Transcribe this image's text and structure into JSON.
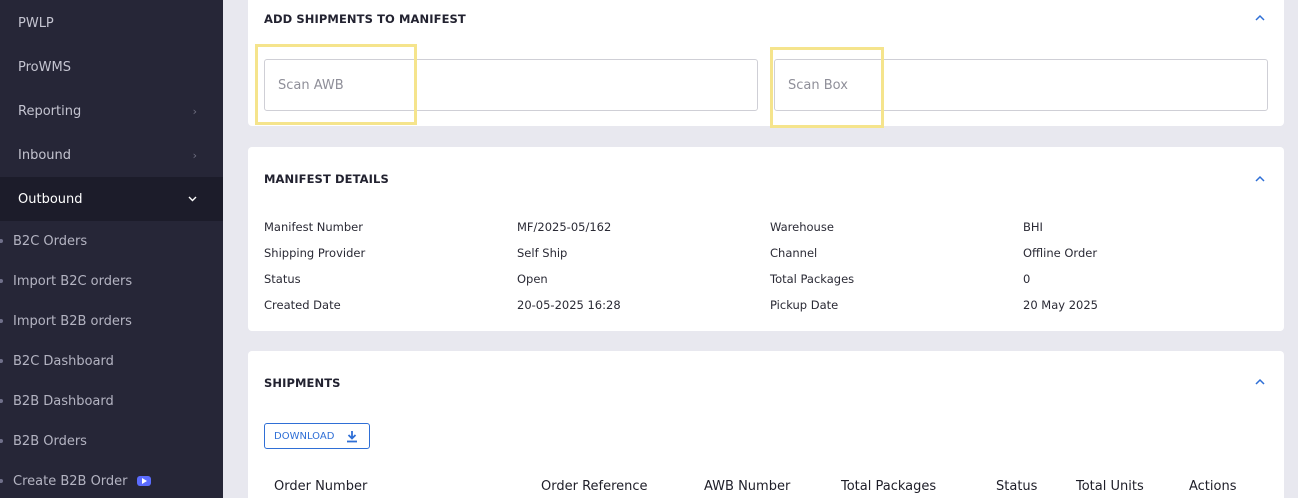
{
  "sidebar": {
    "items": [
      {
        "label": "PWLP"
      },
      {
        "label": "ProWMS"
      },
      {
        "label": "Reporting",
        "chevron": "›"
      },
      {
        "label": "Inbound",
        "chevron": "›"
      },
      {
        "label": "Outbound",
        "chevron": "⌄"
      }
    ],
    "sub_items": [
      {
        "label": "B2C Orders"
      },
      {
        "label": "Import B2C orders"
      },
      {
        "label": "Import B2B orders"
      },
      {
        "label": "B2C Dashboard"
      },
      {
        "label": "B2B Dashboard"
      },
      {
        "label": "B2B Orders"
      },
      {
        "label": "Create B2B Order",
        "icon": "video-icon"
      }
    ]
  },
  "add_shipments": {
    "title": "ADD SHIPMENTS TO MANIFEST",
    "awb_placeholder": "Scan AWB",
    "box_placeholder": "Scan Box"
  },
  "manifest_details": {
    "title": "MANIFEST DETAILS",
    "rows": [
      {
        "label1": "Manifest Number",
        "value1": "MF/2025-05/162",
        "label2": "Warehouse",
        "value2": "BHI"
      },
      {
        "label1": "Shipping Provider",
        "value1": "Self Ship",
        "label2": "Channel",
        "value2": "Offline Order"
      },
      {
        "label1": "Status",
        "value1": "Open",
        "label2": "Total Packages",
        "value2": "0"
      },
      {
        "label1": "Created Date",
        "value1": "20-05-2025 16:28",
        "label2": "Pickup Date",
        "value2": "20 May 2025"
      }
    ]
  },
  "shipments": {
    "title": "SHIPMENTS",
    "download_label": "DOWNLOAD",
    "columns": [
      "Order Number",
      "Order Reference",
      "AWB Number",
      "Total Packages",
      "Status",
      "Total Units",
      "Actions"
    ]
  },
  "colors": {
    "sidebar_bg": "#262637",
    "accent": "#2f6fd6",
    "highlight": "#f5e48c"
  }
}
